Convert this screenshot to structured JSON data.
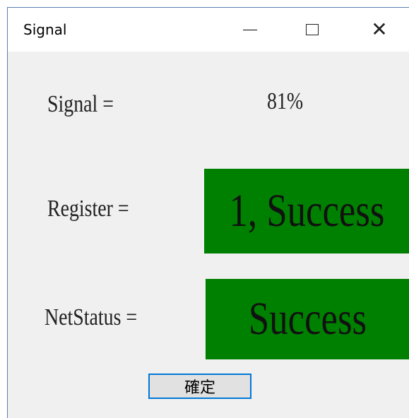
{
  "window": {
    "title": "Signal",
    "close_glyph": "✕"
  },
  "signal": {
    "label": "Signal =",
    "value": "81%"
  },
  "register": {
    "label": "Register =",
    "status": "1, Success",
    "color": "#008000"
  },
  "netstatus": {
    "label": "NetStatus =",
    "status": "Success",
    "color": "#008000"
  },
  "ok_button": {
    "label": "確定"
  },
  "icons": [
    "minimize-icon",
    "maximize-icon",
    "close-icon"
  ]
}
